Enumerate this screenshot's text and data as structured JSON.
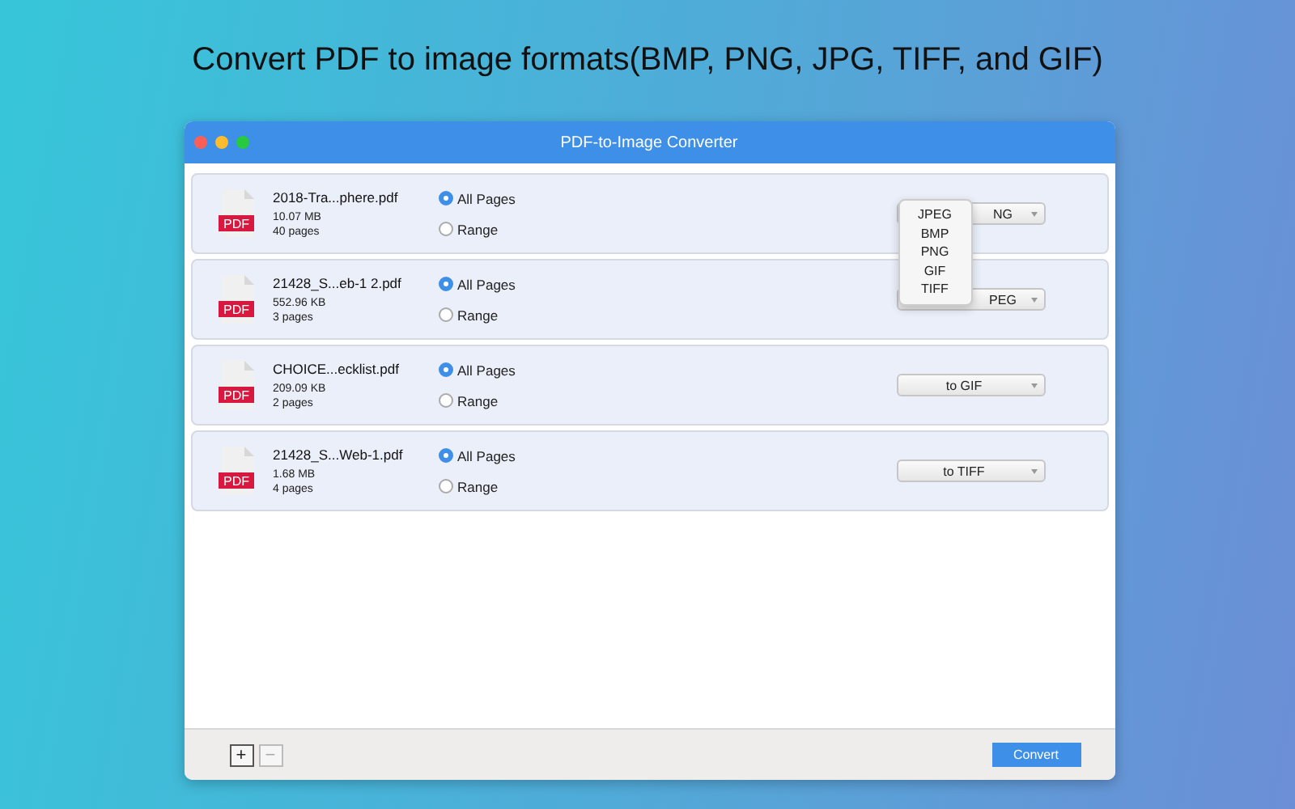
{
  "headline": "Convert PDF to image formats(BMP, PNG, JPG, TIFF, and GIF)",
  "window": {
    "title": "PDF-to-Image Converter"
  },
  "files": [
    {
      "icon_label": "PDF",
      "name": "2018-Tra...phere.pdf",
      "size": "10.07 MB",
      "pages": "40 pages",
      "options": [
        {
          "label": "All Pages",
          "selected": true
        },
        {
          "label": "Range",
          "selected": false
        }
      ],
      "format": {
        "value": "NG",
        "covered": true
      },
      "menu": [
        "JPEG",
        "BMP",
        "PNG",
        "GIF",
        "TIFF"
      ]
    },
    {
      "icon_label": "PDF",
      "name": "21428_S...eb-1 2.pdf",
      "size": "552.96 KB",
      "pages": "3 pages",
      "options": [
        {
          "label": "All Pages",
          "selected": true
        },
        {
          "label": "Range",
          "selected": false
        }
      ],
      "format": {
        "value": "PEG",
        "covered": true
      }
    },
    {
      "icon_label": "PDF",
      "name": "CHOICE...ecklist.pdf",
      "size": "209.09 KB",
      "pages": "2 pages",
      "options": [
        {
          "label": "All Pages",
          "selected": true
        },
        {
          "label": "Range",
          "selected": false
        }
      ],
      "format": {
        "value": "to GIF",
        "covered": false
      }
    },
    {
      "icon_label": "PDF",
      "name": "21428_S...Web-1.pdf",
      "size": "1.68 MB",
      "pages": "4 pages",
      "options": [
        {
          "label": "All Pages",
          "selected": true
        },
        {
          "label": "Range",
          "selected": false
        }
      ],
      "format": {
        "value": "to TIFF",
        "covered": false
      }
    }
  ],
  "footer": {
    "add": "+",
    "remove": "−",
    "convert": "Convert"
  }
}
